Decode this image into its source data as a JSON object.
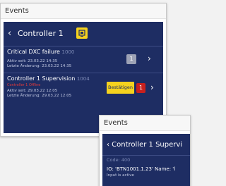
{
  "window_main": {
    "title": "Events",
    "header": {
      "back": "‹",
      "title": "Controller 1"
    },
    "events": [
      {
        "title": "Critical DXC failure",
        "code": "1000",
        "status": "",
        "active_since": "Aktiv seit: 23.03.22 14:35",
        "last_change": "Letzte Änderung: 23.03.22 14:35",
        "counter": "1"
      },
      {
        "title": "Controller 1 Supervision",
        "code": "1004",
        "status": "Controller 1 Offline",
        "active_since": "Aktiv seit: 29.03.22 12:05",
        "last_change": "Letzte Änderung: 29.03.22 12:05",
        "confirm_label": "Bestätigen",
        "counter": "1"
      }
    ],
    "chevron": "›"
  },
  "window_detail": {
    "title": "Events",
    "header": "‹  Controller 1 Supervi",
    "code": "Code: 400",
    "io_line": "IO: 'BTN1001.1.23' Name: 'l",
    "io_status": "Input is active"
  },
  "colors": {
    "panel_bg": "#1e2d63",
    "accent_yellow": "#f5d21e",
    "alarm_red": "#c8201e",
    "neutral_grey": "#9da2b5"
  }
}
